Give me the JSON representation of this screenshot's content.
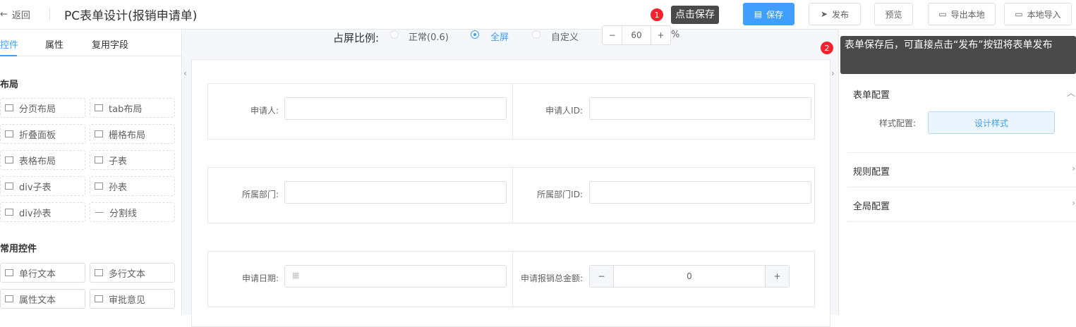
{
  "header": {
    "back_label": "返回",
    "title": "PC表单设计(报销申请单)",
    "buttons": {
      "save": "保存",
      "publish": "发布",
      "preview": "预览",
      "export": "导出本地",
      "import": "本地导入"
    },
    "tip1_num": "1",
    "tip1_text": "点击保存",
    "tip2_num": "2",
    "tip2_text": "表单保存后，可直接点击“发布”按钮将表单发布"
  },
  "left": {
    "tabs": [
      "控件",
      "属性",
      "复用字段"
    ],
    "layout_title": "布局",
    "layout_items": [
      "分页布局",
      "tab布局",
      "折叠面板",
      "栅格布局",
      "表格布局",
      "子表",
      "div子表",
      "孙表",
      "div孙表",
      "分割线"
    ],
    "common_title": "常用控件",
    "common_items": [
      "单行文本",
      "多行文本",
      "属性文本",
      "审批意见"
    ]
  },
  "center": {
    "ratio_label": "占屏比例:",
    "options": [
      "正常(0.6)",
      "全屏",
      "自定义"
    ],
    "selected": "全屏",
    "custom_value": "60",
    "percent": "%",
    "minus": "−",
    "plus": "+",
    "fields": [
      {
        "label": "申请人:",
        "value": ""
      },
      {
        "label": "申请人ID:",
        "value": ""
      },
      {
        "label": "所属部门:",
        "value": ""
      },
      {
        "label": "所属部门ID:",
        "value": ""
      },
      {
        "label": "申请日期:",
        "value": ""
      },
      {
        "label": "申请报销总金额:",
        "value": "0"
      }
    ]
  },
  "right": {
    "sections": [
      "表单配置",
      "规则配置",
      "全局配置"
    ],
    "style_label": "样式配置:",
    "style_button": "设计样式"
  }
}
